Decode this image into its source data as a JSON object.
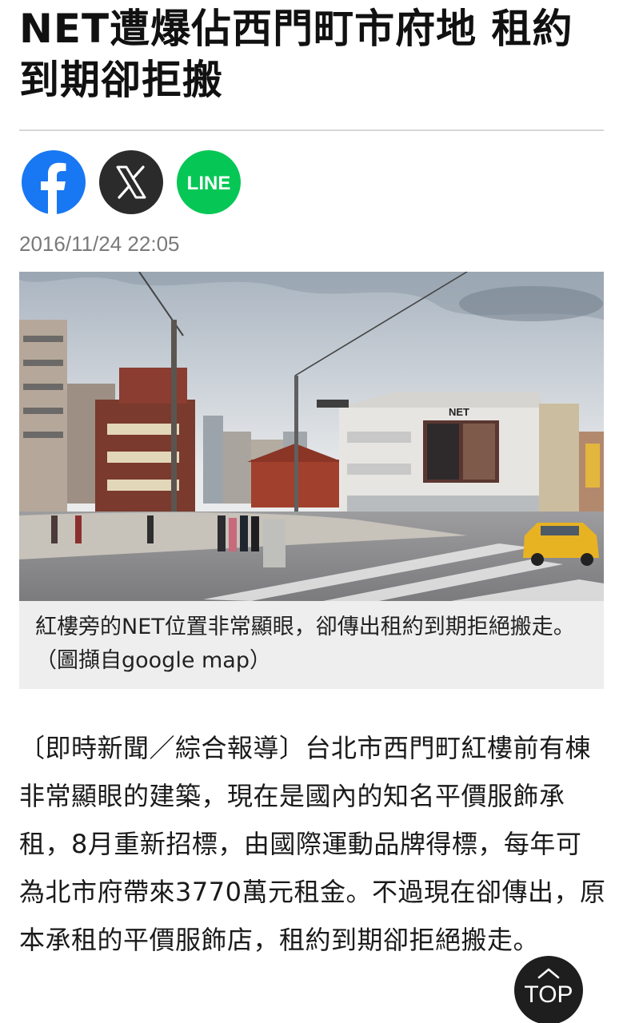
{
  "article": {
    "title": "NET遭爆佔西門町市府地 租約到期卻拒搬",
    "published": "2016/11/24 22:05",
    "image": {
      "sign_text": "NET",
      "caption": "紅樓旁的NET位置非常顯眼，卻傳出租約到期拒絕搬走。（圖擷自google map）"
    },
    "body": "〔即時新聞／綜合報導〕台北市西門町紅樓前有棟非常顯眼的建築，現在是國內的知名平價服飾承租，8月重新招標，由國際運動品牌得標，每年可為北市府帶來3770萬元租金。不過現在卻傳出，原本承租的平價服飾店，租約到期卻拒絕搬走。"
  },
  "share": {
    "facebook": {
      "icon": "facebook-icon",
      "color": "#1877f2"
    },
    "x": {
      "icon": "x-icon",
      "color": "#2b2b2b"
    },
    "line": {
      "icon": "line-icon",
      "label": "LINE",
      "color": "#06c755"
    }
  },
  "scroll_top": {
    "label": "TOP",
    "icon": "caret-up-icon"
  }
}
